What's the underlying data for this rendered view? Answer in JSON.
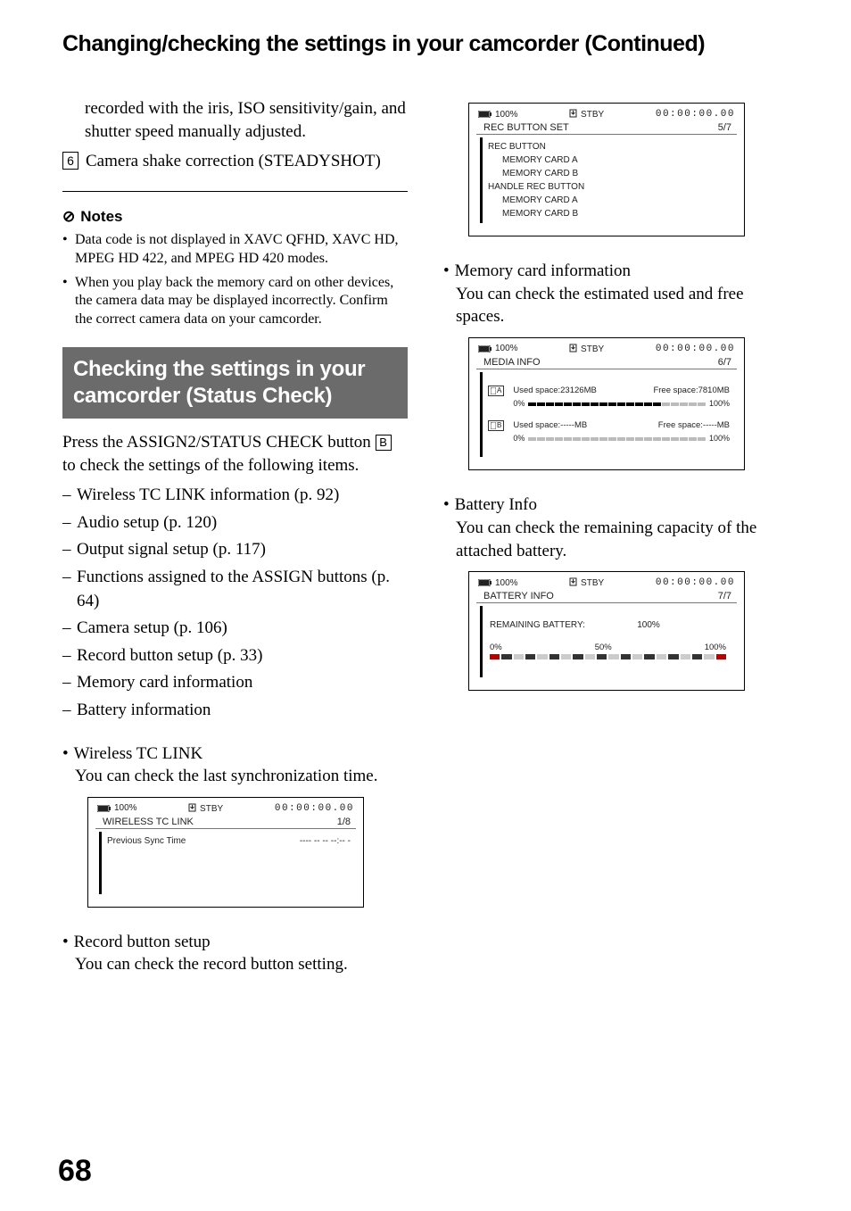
{
  "page_title": "Changing/checking the settings in your camcorder (Continued)",
  "left": {
    "carry_text": "recorded with the iris, ISO sensitivity/gain, and shutter speed manually adjusted.",
    "item6_num": "6",
    "item6_text": "Camera shake correction (STEADYSHOT)",
    "notes_icon": "⊘",
    "notes_label": "Notes",
    "notes": [
      "Data code is not displayed in XAVC QFHD, XAVC HD, MPEG HD 422, and MPEG HD 420 modes.",
      "When you play back the memory card on other devices, the camera data may be displayed incorrectly. Confirm the correct camera data on your camcorder."
    ],
    "section_title": "Checking the settings in your camcorder (Status Check)",
    "intro_a": "Press the ASSIGN2/STATUS CHECK button ",
    "intro_box": "B",
    "intro_b": " to check the settings of the following items.",
    "dash_items": [
      "Wireless TC LINK information (p. 92)",
      "Audio setup (p. 120)",
      "Output signal setup (p. 117)",
      "Functions assigned to the ASSIGN buttons (p. 64)",
      "Camera setup (p. 106)",
      "Record button setup (p. 33)",
      "Memory card information",
      "Battery information"
    ],
    "tc_title": "Wireless TC LINK",
    "tc_desc": "You can check the last synchronization time.",
    "rec_title": "Record button setup",
    "rec_desc": "You can check the record button setting."
  },
  "right": {
    "mem_title": "Memory card information",
    "mem_desc": "You can check the estimated used and free spaces.",
    "batt_title": "Battery Info",
    "batt_desc": "You can check the remaining capacity of the attached battery."
  },
  "lcd": {
    "batt_icon_pct": "100%",
    "rec_flag": "STBY",
    "timecode": "00:00:00.00",
    "prev_sync_value": "---- -- -- --:-- -",
    "wireless": {
      "title": "WIRELESS TC LINK",
      "page": "1/8",
      "row1": "Previous Sync Time"
    },
    "recbtn": {
      "title": "REC BUTTON SET",
      "page": "5/7",
      "r1": "REC BUTTON",
      "r1a": "MEMORY CARD A",
      "r1b": "MEMORY CARD B",
      "r2": "HANDLE REC BUTTON",
      "r2a": "MEMORY CARD A",
      "r2b": "MEMORY CARD B"
    },
    "media": {
      "title": "MEDIA INFO",
      "page": "6/7",
      "slotA": "A",
      "slotB": "B",
      "a_used": "Used space:23126MB",
      "a_free": "Free space:7810MB",
      "b_used": "Used space:-----MB",
      "b_free": "Free space:-----MB",
      "pct0": "0%",
      "pct100": "100%"
    },
    "battery": {
      "title": "BATTERY INFO",
      "page": "7/7",
      "remain_label": "REMAINING BATTERY:",
      "remain_value": "100%",
      "s0": "0%",
      "s50": "50%",
      "s100": "100%"
    }
  },
  "page_number": "68"
}
